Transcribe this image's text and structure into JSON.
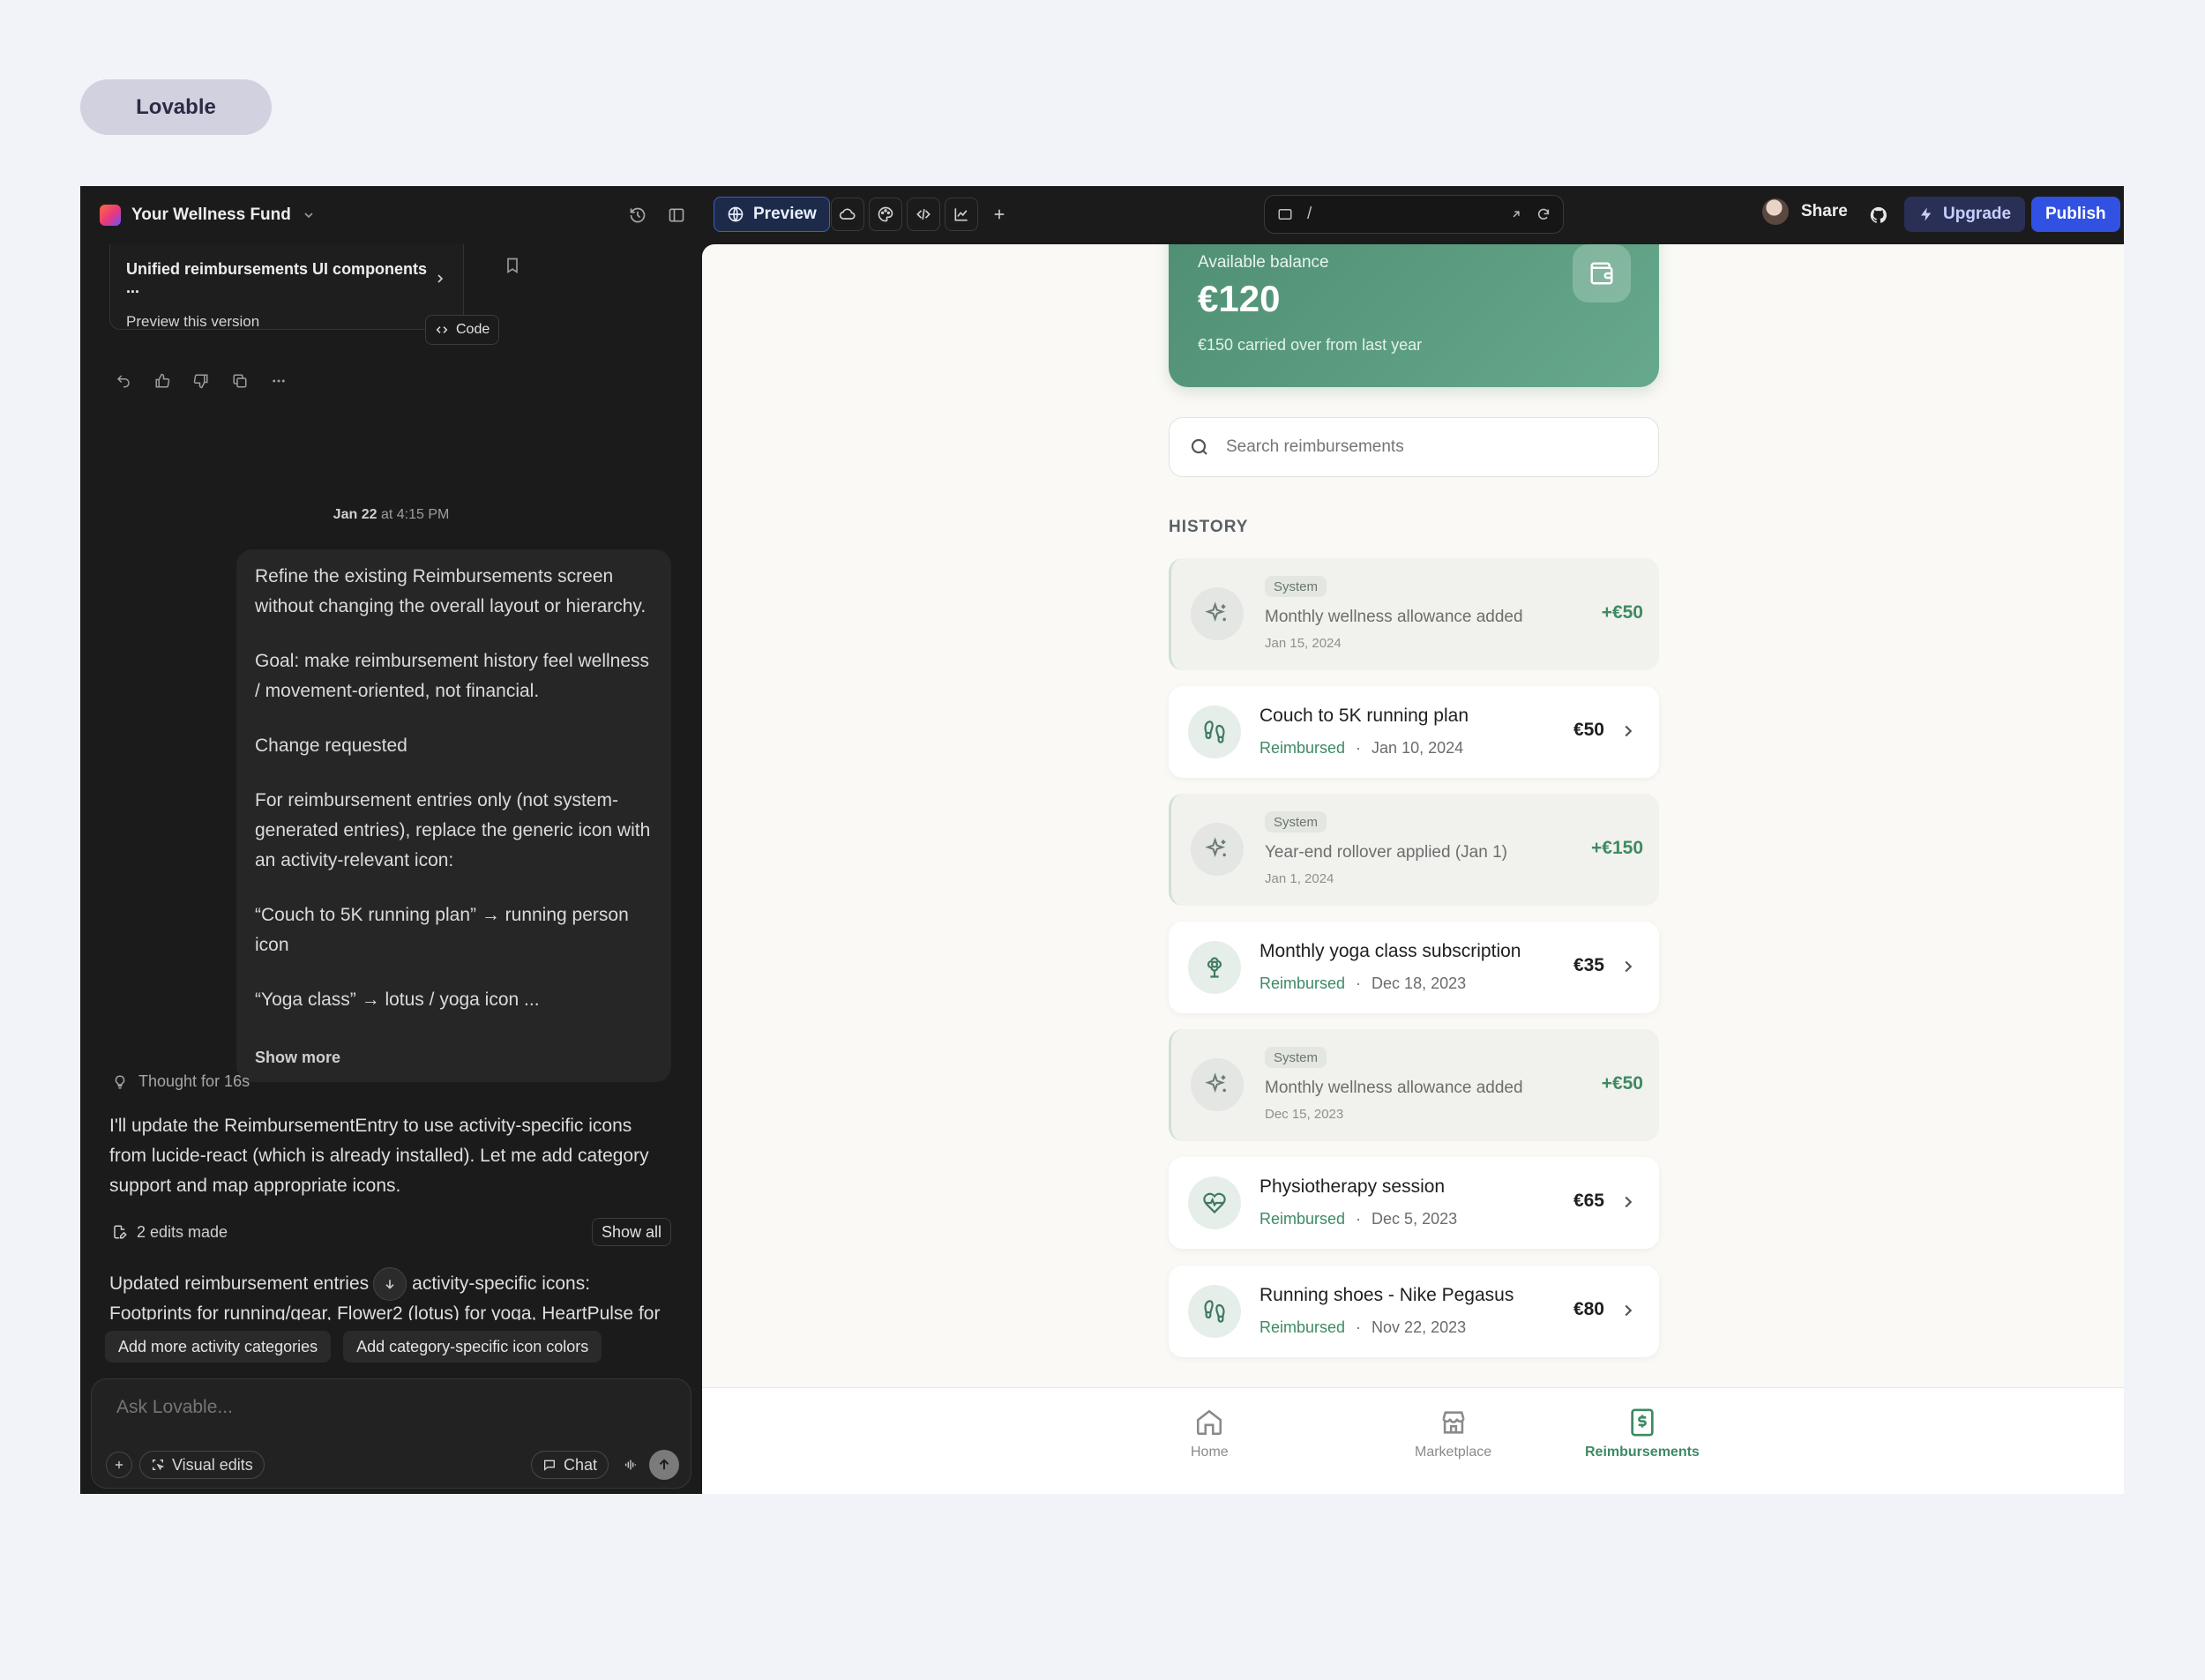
{
  "badge": {
    "label": "Lovable"
  },
  "topbar": {
    "project_name": "Your Wellness Fund",
    "preview_label": "Preview",
    "url_path": "/",
    "share_label": "Share",
    "upgrade_label": "Upgrade",
    "publish_label": "Publish"
  },
  "chat": {
    "version_card": {
      "title": "Unified reimbursements UI components ...",
      "subtitle": "Preview this version",
      "code_label": "Code"
    },
    "timestamp": {
      "date": "Jan 22",
      "time": "at 4:15 PM"
    },
    "user_message": {
      "paragraphs": [
        "Refine the existing Reimbursements screen without changing the overall layout or hierarchy.",
        "Goal: make reimbursement history feel wellness / movement-oriented, not financial.",
        "Change requested",
        "For reimbursement entries only (not system-generated entries), replace the generic icon with an activity-relevant icon:",
        "“Couch to 5K running plan” → running person icon",
        "“Yoga class” → lotus / yoga icon ..."
      ],
      "show_more": "Show more"
    },
    "thought": "Thought for 16s",
    "assistant_text": "I'll update the ReimbursementEntry to use activity-specific icons from lucide-react (which is already installed). Let me add category support and map appropriate icons.",
    "edits": {
      "label": "2 edits made",
      "show_all": "Show all"
    },
    "updated_text": "Updated reimbursement entries with activity-specific icons: Footprints for running/gear, Flower2 (lotus) for yoga, HeartPulse for",
    "suggestions": [
      "Add more activity categories",
      "Add category-specific icon colors"
    ],
    "composer": {
      "placeholder": "Ask Lovable...",
      "visual_edits": "Visual edits",
      "chat_label": "Chat"
    }
  },
  "preview": {
    "balance": {
      "label": "Available balance",
      "amount": "€120",
      "note": "€150 carried over from last year"
    },
    "search_placeholder": "Search reimbursements",
    "history_title": "HISTORY",
    "entries": [
      {
        "kind": "system",
        "tag": "System",
        "text": "Monthly wellness allowance added",
        "date": "Jan 15, 2024",
        "amount": "+€50",
        "icon": "sparkles-icon"
      },
      {
        "kind": "reimbursement",
        "title": "Couch to 5K running plan",
        "status": "Reimbursed",
        "date": "Jan 10, 2024",
        "amount": "€50",
        "icon": "footprints-icon"
      },
      {
        "kind": "system",
        "tag": "System",
        "text": "Year-end rollover applied (Jan 1)",
        "date": "Jan 1, 2024",
        "amount": "+€150",
        "icon": "sparkles-icon"
      },
      {
        "kind": "reimbursement",
        "title": "Monthly yoga class subscription",
        "status": "Reimbursed",
        "date": "Dec 18, 2023",
        "amount": "€35",
        "icon": "lotus-icon"
      },
      {
        "kind": "system",
        "tag": "System",
        "text": "Monthly wellness allowance added",
        "date": "Dec 15, 2023",
        "amount": "+€50",
        "icon": "sparkles-icon"
      },
      {
        "kind": "reimbursement",
        "title": "Physiotherapy session",
        "status": "Reimbursed",
        "date": "Dec 5, 2023",
        "amount": "€65",
        "icon": "heart-pulse-icon"
      },
      {
        "kind": "reimbursement",
        "title": "Running shoes - Nike Pegasus",
        "status": "Reimbursed",
        "date": "Nov 22, 2023",
        "amount": "€80",
        "icon": "footprints-icon"
      }
    ],
    "nav": [
      {
        "label": "Home",
        "icon": "home-icon",
        "active": false
      },
      {
        "label": "Marketplace",
        "icon": "store-icon",
        "active": false
      },
      {
        "label": "Reimbursements",
        "icon": "receipt-dollar-icon",
        "active": true
      }
    ],
    "colors": {
      "accent_green": "#3d8a63",
      "publish_blue": "#3151e3"
    }
  }
}
